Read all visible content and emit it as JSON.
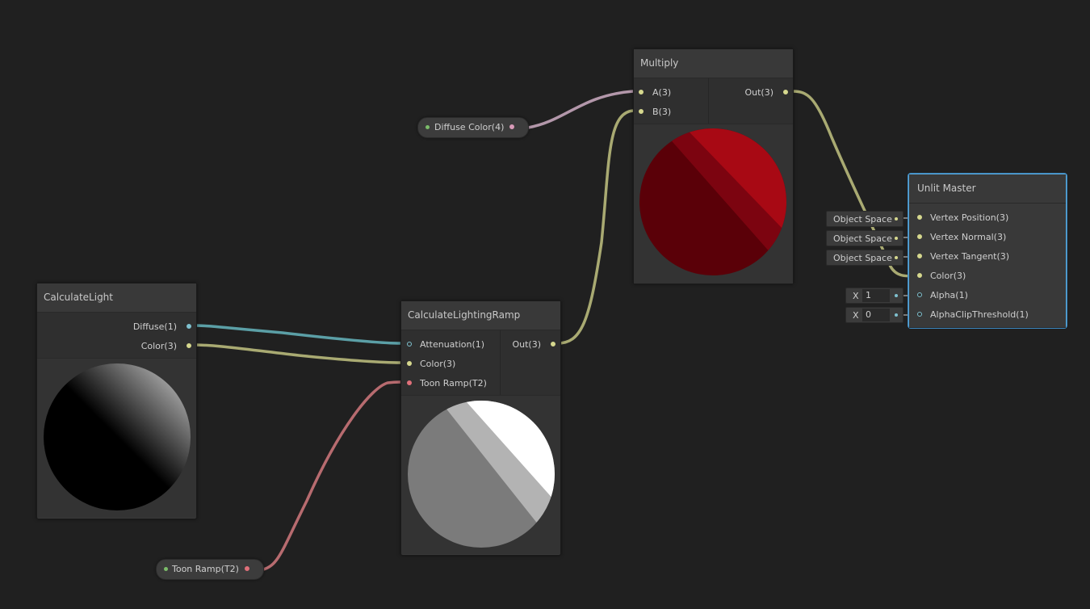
{
  "nodes": {
    "multiply": {
      "title": "Multiply",
      "inputs": [
        "A(3)",
        "B(3)"
      ],
      "output": "Out(3)"
    },
    "calculate_light": {
      "title": "CalculateLight",
      "outputs": [
        "Diffuse(1)",
        "Color(3)"
      ]
    },
    "calculate_lighting_ramp": {
      "title": "CalculateLightingRamp",
      "inputs": [
        "Attenuation(1)",
        "Color(3)",
        "Toon Ramp(T2)"
      ],
      "output": "Out(3)"
    },
    "unlit_master": {
      "title": "Unlit Master",
      "inputs": [
        "Vertex Position(3)",
        "Vertex Normal(3)",
        "Vertex Tangent(3)",
        "Color(3)",
        "Alpha(1)",
        "AlphaClipThreshold(1)"
      ],
      "space_fields": [
        "Object Space",
        "Object Space",
        "Object Space"
      ],
      "alpha_field": {
        "axis": "X",
        "value": "1"
      },
      "clip_field": {
        "axis": "X",
        "value": "0"
      }
    }
  },
  "properties": {
    "diffuse_color": "Diffuse Color(4)",
    "toon_ramp": "Toon Ramp(T2)"
  },
  "colors": {
    "background": "#202020",
    "wire_vector3": "#a9aa72",
    "wire_vector1": "#5b9fa6",
    "wire_texture": "#b76b6f",
    "wire_vector4": "#b397aa",
    "selection": "#58a6d6"
  }
}
